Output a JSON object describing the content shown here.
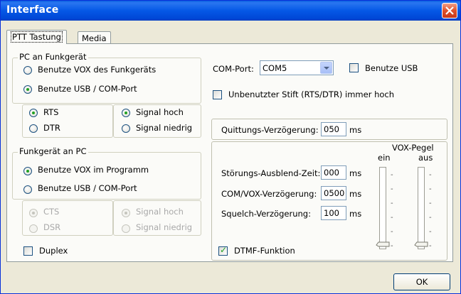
{
  "window": {
    "title": "Interface"
  },
  "tabs": [
    {
      "label": "PTT Tastung"
    },
    {
      "label": "Media"
    }
  ],
  "pc_to_radio": {
    "legend": "PC an Funkgerät",
    "options": [
      {
        "label": "Benutze VOX des Funkgeräts",
        "checked": false
      },
      {
        "label": "Benutze USB / COM-Port",
        "checked": true
      }
    ],
    "line_options": [
      {
        "label": "RTS",
        "checked": true
      },
      {
        "label": "DTR",
        "checked": false
      }
    ],
    "signal_options": [
      {
        "label": "Signal hoch",
        "checked": true
      },
      {
        "label": "Signal niedrig",
        "checked": false
      }
    ]
  },
  "radio_to_pc": {
    "legend": "Funkgerät an PC",
    "options": [
      {
        "label": "Benutze VOX im Programm",
        "checked": true
      },
      {
        "label": "Benutze USB / COM-Port",
        "checked": false
      }
    ],
    "line_options": [
      {
        "label": "CTS",
        "checked": true
      },
      {
        "label": "DSR",
        "checked": false
      }
    ],
    "signal_options": [
      {
        "label": "Signal hoch",
        "checked": true
      },
      {
        "label": "Signal niedrig",
        "checked": false
      }
    ]
  },
  "duplex": {
    "label": "Duplex",
    "checked": false
  },
  "com_port": {
    "label": "COM-Port:",
    "value": "COM5"
  },
  "use_usb": {
    "label": "Benutze USB",
    "checked": false
  },
  "unused_pin": {
    "label": "Unbenutzter Stift (RTS/DTR) immer hoch",
    "checked": false
  },
  "ack_delay": {
    "label": "Quittungs-Verzögerung:",
    "value": "050",
    "unit": "ms"
  },
  "noise_blank": {
    "label": "Störungs-Ausblend-Zeit:",
    "value": "000",
    "unit": "ms"
  },
  "com_vox_delay": {
    "label": "COM/VOX-Verzögerung:",
    "value": "0500",
    "unit": "ms"
  },
  "squelch_delay": {
    "label": "Squelch-Verzögerung:",
    "value": "100",
    "unit": "ms"
  },
  "dtmf": {
    "label": "DTMF-Funktion",
    "checked": true
  },
  "vox_level": {
    "title": "VOX-Pegel",
    "on_label": "ein",
    "off_label": "aus",
    "on_value": 0,
    "off_value": 0
  },
  "ok_button": {
    "label": "OK"
  }
}
